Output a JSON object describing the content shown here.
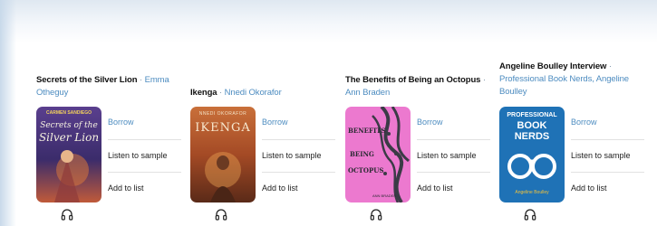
{
  "actions": {
    "borrow": "Borrow",
    "listen": "Listen to sample",
    "add": "Add to list"
  },
  "books": [
    {
      "title": "Secrets of the Silver Lion",
      "separator": " · ",
      "author": "Emma Otheguy",
      "cover": {
        "top_text": "CARMEN SANDIEGO",
        "line1": "Secrets of the",
        "line2": "Silver Lion",
        "bg": "#3b2c6b",
        "accent": "#d9763a"
      }
    },
    {
      "title": "Ikenga",
      "separator": " · ",
      "author": "Nnedi Okorafor",
      "cover": {
        "top_text": "NNEDI OKORAFOR",
        "line1": "IKENGA",
        "bg": "#b45a2c",
        "accent": "#e6a052"
      }
    },
    {
      "title": "The Benefits of Being an Octopus",
      "separator": " · ",
      "author": "Ann Braden",
      "cover": {
        "line1": "BENEFITS",
        "line2": "BEING",
        "line3": "OCTOPUS",
        "bottom_text": "ANN BRADEN",
        "bg": "#e970c9",
        "accent": "#3b3b46"
      }
    },
    {
      "title": "Angeline Boulley Interview",
      "separator": " · ",
      "author": "Professional Book Nerds, Angeline Boulley",
      "cover": {
        "line1": "PROFESSIONAL",
        "line2": "BOOK",
        "line3": "NERDS",
        "bottom_text": "Angeline Boulley",
        "bg": "#1f6fb2",
        "accent": "#ffffff"
      }
    }
  ],
  "colors": {
    "link": "#4d8cc0",
    "title": "#111111",
    "divider": "#e2e2e2"
  }
}
